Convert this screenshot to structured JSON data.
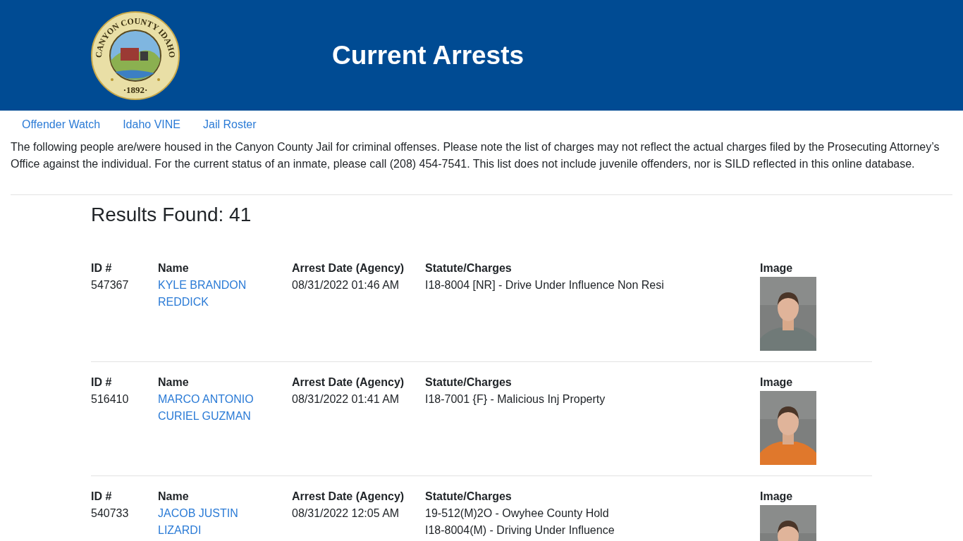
{
  "header": {
    "seal_name": "CANYON COUNTY IDAHO",
    "seal_year": "·1892·",
    "title": "Current Arrests"
  },
  "nav": [
    {
      "label": "Offender Watch"
    },
    {
      "label": "Idaho VINE"
    },
    {
      "label": "Jail Roster"
    }
  ],
  "notice": "The following people are/were housed in the Canyon County Jail for criminal offenses. Please note the list of charges may not reflect the actual charges filed by the Prosecuting Attorney’s Office against the individual. For the current status of an inmate, please call (208) 454-7541. This list does not include juvenile offenders, nor is SILD reflected in this online database.",
  "results": "Results Found: 41",
  "records": [
    {
      "columns": [
        "ID #",
        "Name",
        "Arrest Date (Agency)",
        "Statute/Charges",
        "Image"
      ],
      "id": "547367",
      "name": "KYLE BRANDON REDDICK",
      "arrest_date": "08/31/2022 01:46 AM",
      "charges": [
        "I18-8004 [NR] - Drive Under Influence Non Resi"
      ],
      "image": {
        "kind": "picture"
      }
    },
    {
      "columns": [
        "ID #",
        "Name",
        "Arrest Date (Agency)",
        "Statute/Charges",
        "Image"
      ],
      "id": "516410",
      "name": "MARCO ANTONIO CURIEL GUZMAN",
      "arrest_date": "08/31/2022 01:41 AM",
      "charges": [
        "I18-7001 {F} - Malicious Inj Property"
      ],
      "image": {
        "kind": "picture"
      }
    },
    {
      "columns": [
        "ID #",
        "Name",
        "Arrest Date (Agency)",
        "Statute/Charges",
        "Image"
      ],
      "id": "540733",
      "name": "JACOB JUSTIN LIZARDI",
      "arrest_date": "08/31/2022 12:05 AM",
      "charges": [
        "19-512(M)2O - Owyhee County Hold",
        "I18-8004(M) - Driving Under Influence"
      ],
      "image": {
        "kind": "picture"
      }
    }
  ]
}
